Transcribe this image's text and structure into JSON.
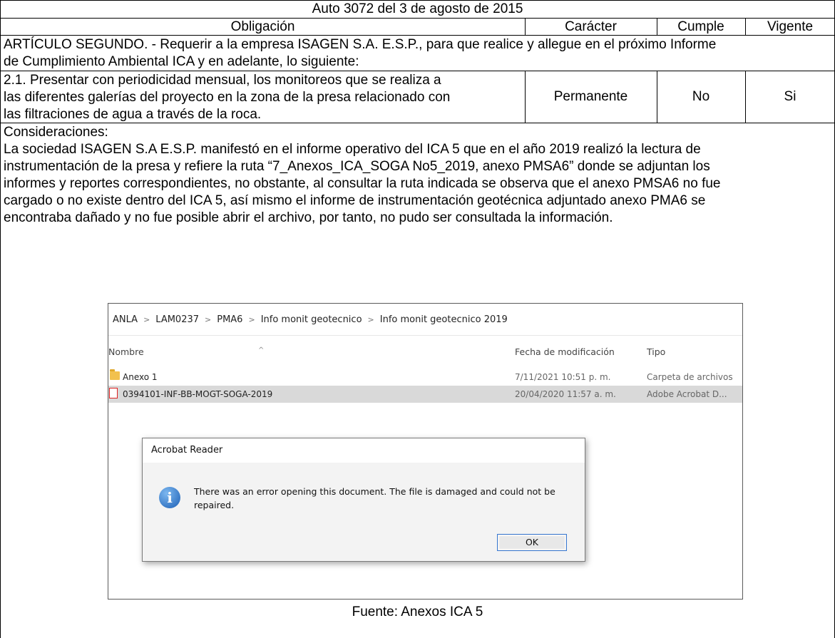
{
  "title": "Auto 3072 del 3 de agosto de 2015",
  "headers": {
    "obligacion": "Obligación",
    "caracter": "Carácter",
    "cumple": "Cumple",
    "vigente": "Vigente"
  },
  "articulo": {
    "line1": "ARTÍCULO SEGUNDO. - Requerir a la empresa ISAGEN S.A. E.S.P., para que realice y allegue en el próximo Informe",
    "line2": "de Cumplimiento Ambiental ICA y en adelante, lo siguiente:"
  },
  "item": {
    "line1": "2.1. Presentar con periodicidad mensual, los monitoreos que se realiza a",
    "line2": "las diferentes galerías del proyecto en la zona de la presa relacionado con",
    "line3": "las filtraciones de agua a través de la roca.",
    "caracter": "Permanente",
    "cumple": "No",
    "vigente": "Si"
  },
  "consideraciones": {
    "label": "Consideraciones:",
    "lines": [
      "La sociedad ISAGEN S.A E.S.P. manifestó en el informe operativo del ICA 5 que en el año 2019 realizó la lectura de",
      "instrumentación de la presa y refiere la ruta “7_Anexos_ICA_SOGA No5_2019, anexo PMSA6” donde se adjuntan los",
      "informes y reportes correspondientes, no obstante, al consultar la ruta indicada se observa que el anexo PMSA6 no fue",
      "cargado o no existe dentro del ICA 5, así mismo el informe de instrumentación geotécnica adjuntado anexo PMA6 se",
      "encontraba dañado y no fue posible abrir el archivo, por tanto, no pudo ser consultada la información."
    ]
  },
  "screenshot": {
    "breadcrumb": [
      "ANLA",
      "LAM0237",
      "PMA6",
      "Info monit geotecnico",
      "Info monit geotecnico 2019"
    ],
    "breadcrumb_sep": ">",
    "sort_caret": "^",
    "columns": {
      "name": "Nombre",
      "date": "Fecha de modificación",
      "type": "Tipo"
    },
    "files": [
      {
        "name": "Anexo 1",
        "date": "7/11/2021 10:51 p. m.",
        "type": "Carpeta de archivos",
        "icon": "folder-icon"
      },
      {
        "name": "0394101-INF-BB-MOGT-SOGA-2019",
        "date": "20/04/2020 11:57 a. m.",
        "type": "Adobe Acrobat D...",
        "icon": "pdf-icon"
      }
    ],
    "dialog": {
      "title": "Acrobat Reader",
      "icon_glyph": "i",
      "message": "There was an error opening this document. The file is damaged and could not be repaired.",
      "ok": "OK"
    }
  },
  "fuente": "Fuente: Anexos ICA 5"
}
